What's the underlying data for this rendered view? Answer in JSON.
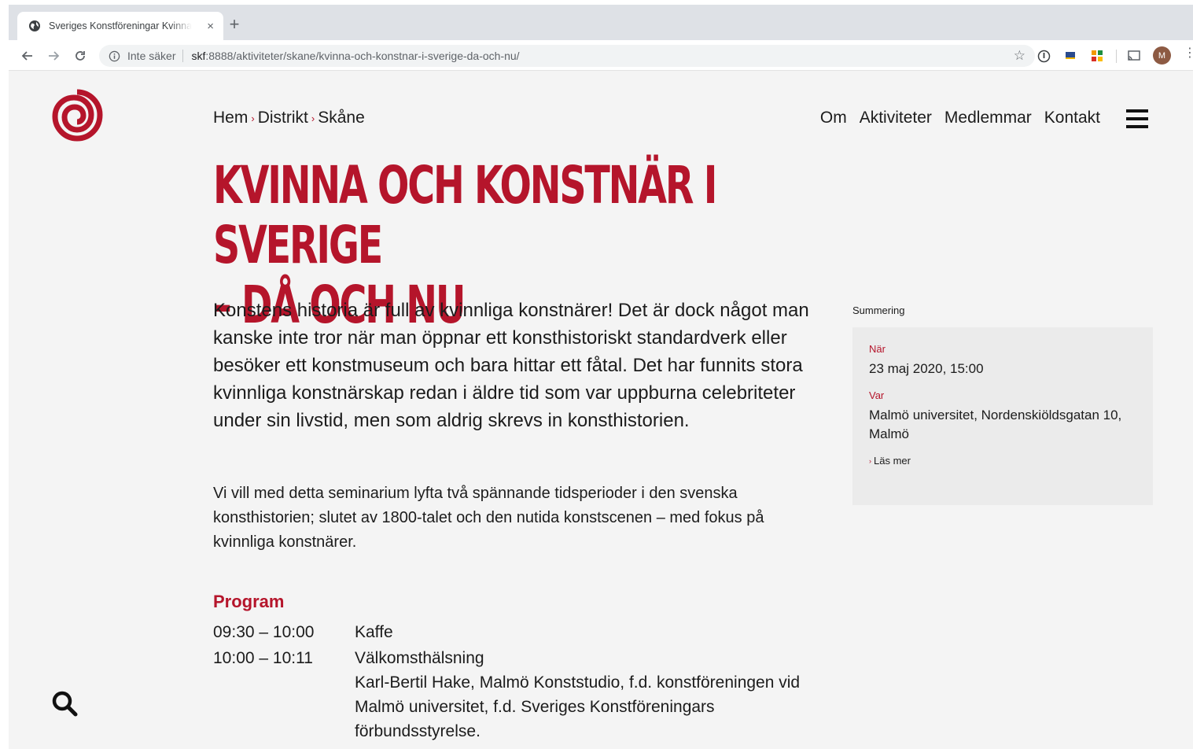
{
  "browser": {
    "tab_title": "Sveriges Konstföreningar Kvinna och konstnär i Sverige",
    "tab_close": "×",
    "new_tab": "+",
    "security_label": "Inte säker",
    "url_host": "skf",
    "url_rest": ":8888/aktiviteter/skane/kvinna-och-konstnar-i-sverige-da-och-nu/",
    "star": "☆",
    "avatar_initial": "M",
    "menu": "⋮"
  },
  "site": {
    "breadcrumb": [
      "Hem",
      "Distrikt",
      "Skåne"
    ],
    "breadcrumb_separator": "›",
    "nav": [
      "Om",
      "Aktiviteter",
      "Medlemmar",
      "Kontakt"
    ],
    "accent_color": "#b5152b"
  },
  "article": {
    "title_line1": "KVINNA OCH KONSTNÄR I SVERIGE",
    "title_line2": "– DÅ OCH NU",
    "lead": "Konstens historia är full av kvinnliga konstnärer! Det är dock något man kanske inte tror när man öppnar ett konsthistoriskt standardverk eller besöker ett konstmuseum och bara hittar ett fåtal. Det har funnits stora kvinnliga konstnärskap redan i äldre tid som var uppburna celebriteter under sin livstid, men som aldrig skrevs in konsthistorien.",
    "body": "Vi vill med detta seminarium lyfta två spännande tidsperioder i den svenska konsthistorien; slutet av 1800-talet och den nutida konstscenen – med fokus på kvinnliga konstnärer.",
    "program_heading": "Program",
    "program": [
      {
        "time": "09:30 – 10:00",
        "desc": "Kaffe"
      },
      {
        "time": "10:00 – 10:11",
        "desc": "Välkomsthälsning\nKarl-Bertil Hake, Malmö Konststudio, f.d. konstföreningen vid Malmö universitet, f.d. Sveriges Konstföreningars förbundsstyrelse."
      }
    ]
  },
  "summary": {
    "label": "Summering",
    "when_label": "När",
    "when_value": "23 maj 2020, 15:00",
    "where_label": "Var",
    "where_value": "Malmö universitet, Nordenskiöldsgatan 10, Malmö",
    "more_label": "Läs mer",
    "more_arrow": "›"
  },
  "icons": {
    "logo": "spiral-logo-icon",
    "search": "search-icon",
    "menu": "hamburger-menu-icon"
  }
}
